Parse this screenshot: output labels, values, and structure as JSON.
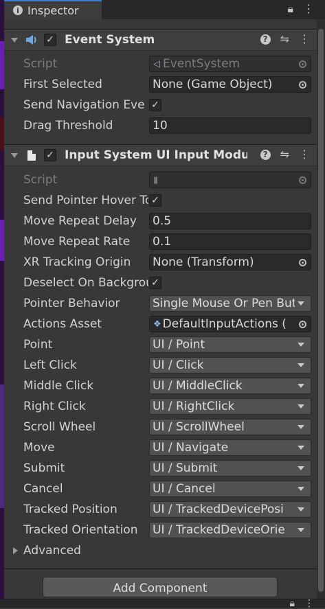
{
  "tab": {
    "title": "Inspector"
  },
  "event_system": {
    "title": "Event System",
    "enabled": true,
    "fields": {
      "script": {
        "label": "Script",
        "value": "EventSystem"
      },
      "first_selected": {
        "label": "First Selected",
        "value": "None (Game Object)"
      },
      "send_navigation": {
        "label": "Send Navigation Eve",
        "checked": true
      },
      "drag_threshold": {
        "label": "Drag Threshold",
        "value": "10"
      }
    }
  },
  "input_module": {
    "title": "Input System UI Input Module",
    "enabled": true,
    "fields": {
      "script": {
        "label": "Script",
        "value": ""
      },
      "send_pointer_hover": {
        "label": "Send Pointer Hover To Parent",
        "checked": true
      },
      "move_repeat_delay": {
        "label": "Move Repeat Delay",
        "value": "0.5"
      },
      "move_repeat_rate": {
        "label": "Move Repeat Rate",
        "value": "0.1"
      },
      "xr_tracking_origin": {
        "label": "XR Tracking Origin",
        "value": "None (Transform)"
      },
      "deselect_on_background": {
        "label": "Deselect On Background Click",
        "checked": true
      },
      "pointer_behavior": {
        "label": "Pointer Behavior",
        "value": "Single Mouse Or Pen But"
      },
      "actions_asset": {
        "label": "Actions Asset",
        "value": "DefaultInputActions ("
      },
      "point": {
        "label": "Point",
        "value": "UI / Point"
      },
      "left_click": {
        "label": "Left Click",
        "value": "UI / Click"
      },
      "middle_click": {
        "label": "Middle Click",
        "value": "UI / MiddleClick"
      },
      "right_click": {
        "label": "Right Click",
        "value": "UI / RightClick"
      },
      "scroll_wheel": {
        "label": "Scroll Wheel",
        "value": "UI / ScrollWheel"
      },
      "move": {
        "label": "Move",
        "value": "UI / Navigate"
      },
      "submit": {
        "label": "Submit",
        "value": "UI / Submit"
      },
      "cancel": {
        "label": "Cancel",
        "value": "UI / Cancel"
      },
      "tracked_position": {
        "label": "Tracked Position",
        "value": "UI / TrackedDevicePosi"
      },
      "tracked_orientation": {
        "label": "Tracked Orientation",
        "value": "UI / TrackedDeviceOrie"
      }
    },
    "advanced": {
      "label": "Advanced"
    }
  },
  "footer": {
    "add_component": "Add Component"
  },
  "icons": {
    "lock": "lock-icon",
    "menu": "kebab-menu-icon",
    "help": "help-icon",
    "presets": "presets-icon",
    "object_picker": "object-picker-icon"
  }
}
